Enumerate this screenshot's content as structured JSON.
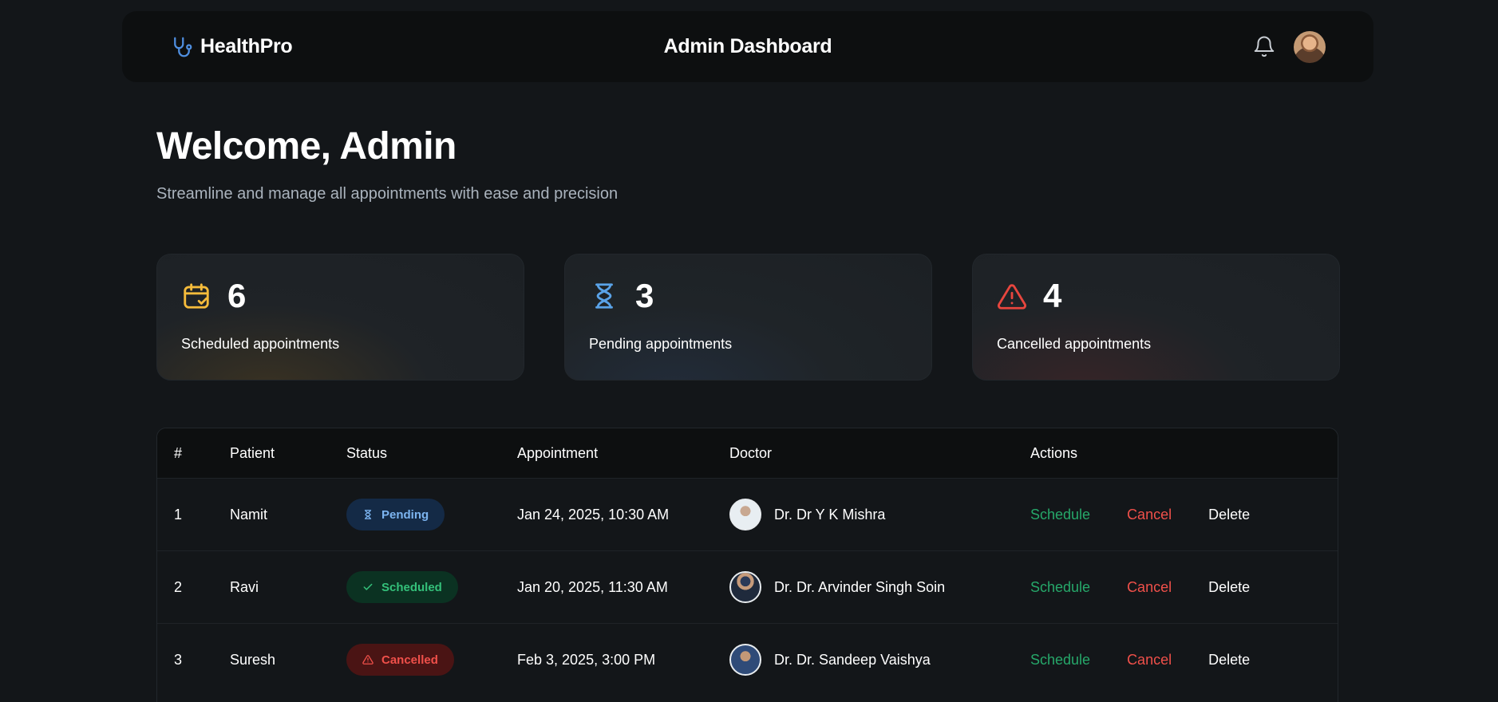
{
  "header": {
    "brand": "HealthPro",
    "title": "Admin Dashboard"
  },
  "welcome": {
    "title": "Welcome, Admin",
    "subtitle": "Streamline and manage all appointments with ease and precision"
  },
  "stats": [
    {
      "count": "6",
      "label": "Scheduled appointments",
      "icon": "calendar-check-icon",
      "color": "#f5bb3b"
    },
    {
      "count": "3",
      "label": "Pending appointments",
      "icon": "hourglass-icon",
      "color": "#5aa3e8"
    },
    {
      "count": "4",
      "label": "Cancelled appointments",
      "icon": "alert-triangle-icon",
      "color": "#e8463e"
    }
  ],
  "table": {
    "headers": [
      "#",
      "Patient",
      "Status",
      "Appointment",
      "Doctor",
      "Actions"
    ],
    "rows": [
      {
        "num": "1",
        "patient": "Namit",
        "status": "Pending",
        "appointment": "Jan 24, 2025, 10:30 AM",
        "doctor": "Dr. Dr Y K Mishra"
      },
      {
        "num": "2",
        "patient": "Ravi",
        "status": "Scheduled",
        "appointment": "Jan 20, 2025, 11:30 AM",
        "doctor": "Dr. Dr. Arvinder Singh Soin"
      },
      {
        "num": "3",
        "patient": "Suresh",
        "status": "Cancelled",
        "appointment": "Feb 3, 2025, 3:00 PM",
        "doctor": "Dr. Dr. Sandeep Vaishya"
      }
    ],
    "actions": {
      "schedule": "Schedule",
      "cancel": "Cancel",
      "delete": "Delete"
    }
  }
}
